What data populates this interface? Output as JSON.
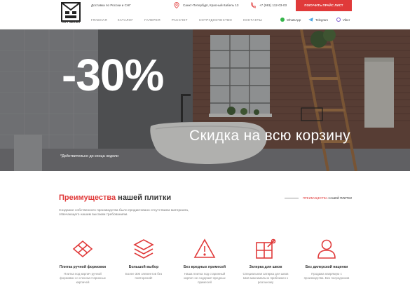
{
  "header": {
    "logo_text": "LOFT BRICKS",
    "delivery": "Доставка по России и СНГ",
    "address": "Санкт-Петербург, Красный Кабель 13",
    "phone": "+7 (981) 112-03-03",
    "price_button": "ПОЛУЧИТЬ ПРАЙС ЛИСТ"
  },
  "nav": {
    "items": [
      "ГЛАВНАЯ",
      "КАТАЛОГ",
      "ГАЛЕРЕЯ",
      "РАССЧЕТ",
      "СОТРУДНИЧЕСТВО",
      "КОНТАКТЫ"
    ]
  },
  "messengers": {
    "whatsapp": "WhatsApp",
    "telegram": "Telegram",
    "viber": "Viber"
  },
  "hero": {
    "discount": "-30%",
    "subtitle": "Скидка на всю корзину",
    "note": "*Действительно до конца недели"
  },
  "advantages": {
    "title_red": "Преимущества",
    "title_dark": "нашей плитки",
    "crumb_red": "ПРЕИМУЩЕСТВА",
    "crumb_dark": "НАШЕЙ ПЛИТКИ",
    "description": "Создание собственного производства было продиктовано отсутствием материала, отвечающего нашим высоким требованиям.",
    "features": [
      {
        "title": "Плитка ручной формовки",
        "text": "Плитка под кирпич ручной формовки со сленом старинных кирпичей"
      },
      {
        "title": "Большой выбор",
        "text": "Более 300 элементов без повторений!"
      },
      {
        "title": "Без вредных примесей",
        "text": "Наша плитка под старинный кирпич не содержит вредных примесей"
      },
      {
        "title": "Затирка для швов",
        "text": "Специальная затирка для швов Шов максимально приближен к реальному"
      },
      {
        "title": "Без дилерской наценки",
        "text": "Продажа напрямую с производства. Без посредников"
      }
    ]
  },
  "colors": {
    "accent": "#e03a3a",
    "hero_bg": "#55565a"
  }
}
